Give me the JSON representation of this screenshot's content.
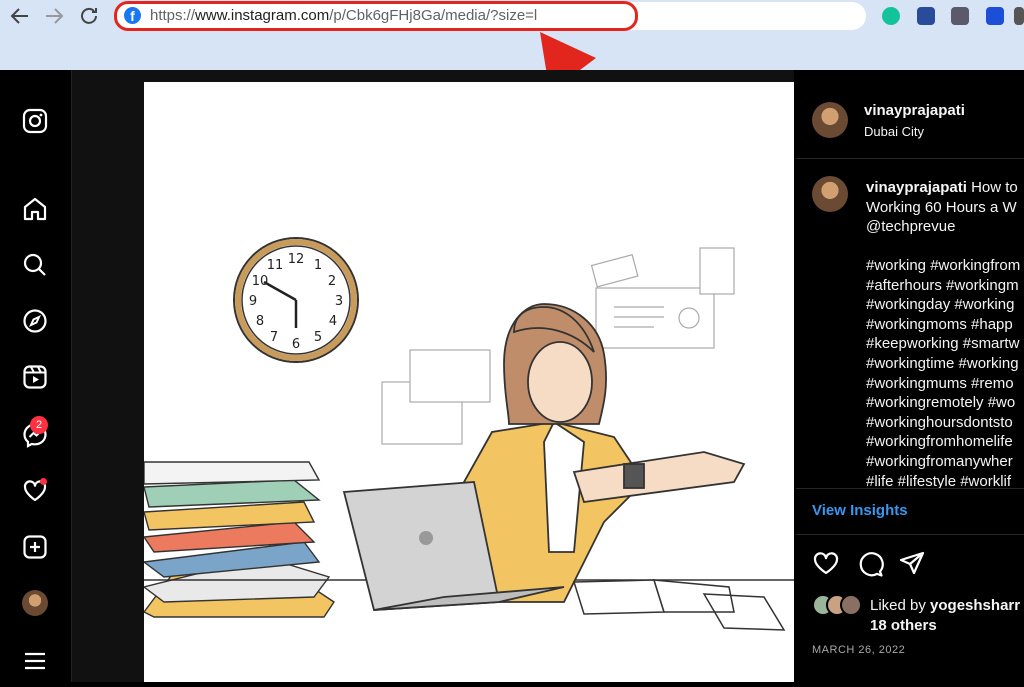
{
  "browser": {
    "back_icon": "arrow-left-icon",
    "forward_icon": "arrow-right-icon",
    "reload_icon": "reload-icon",
    "url_prefix": "https://",
    "url_host": "www.instagram.com",
    "url_path": "/p/Cbk6gFHj8Ga/media/?size=l",
    "favicon_icon": "facebook-icon",
    "highlight_color": "#e3261d",
    "extensions": [
      "grammarly-icon",
      "search-extension-icon",
      "shield-extension-icon",
      "wave-extension-icon"
    ]
  },
  "sidebar": {
    "items": [
      {
        "icon": "instagram-logo-icon"
      },
      {
        "icon": "home-icon"
      },
      {
        "icon": "search-icon"
      },
      {
        "icon": "explore-compass-icon"
      },
      {
        "icon": "reels-icon"
      },
      {
        "icon": "messenger-icon",
        "badge": "2"
      },
      {
        "icon": "heart-icon"
      },
      {
        "icon": "create-plus-icon"
      },
      {
        "icon": "profile-avatar"
      },
      {
        "icon": "menu-icon"
      }
    ]
  },
  "post": {
    "username": "vinayprajapati",
    "location": "Dubai City",
    "caption_lines": [
      "How to",
      "Working 60 Hours a W",
      "@techprevue"
    ],
    "hashtag_lines": [
      "#working #workingfrom",
      "#afterhours #workingm",
      "#workingday #working",
      "#workingmoms #happ",
      "#keepworking #smartw",
      "#workingtime #working",
      "#workingmums #remo",
      "#workingremotely #wo",
      "#workinghoursdontsto",
      "#workingfromhomelife",
      "#workingfromanywher",
      "#life #lifestyle #worklif"
    ],
    "view_insights": "View Insights",
    "liked_prefix": "Liked by ",
    "liked_user": "yogeshsharr",
    "liked_others": "18 others",
    "date": "MARCH 26, 2022"
  }
}
